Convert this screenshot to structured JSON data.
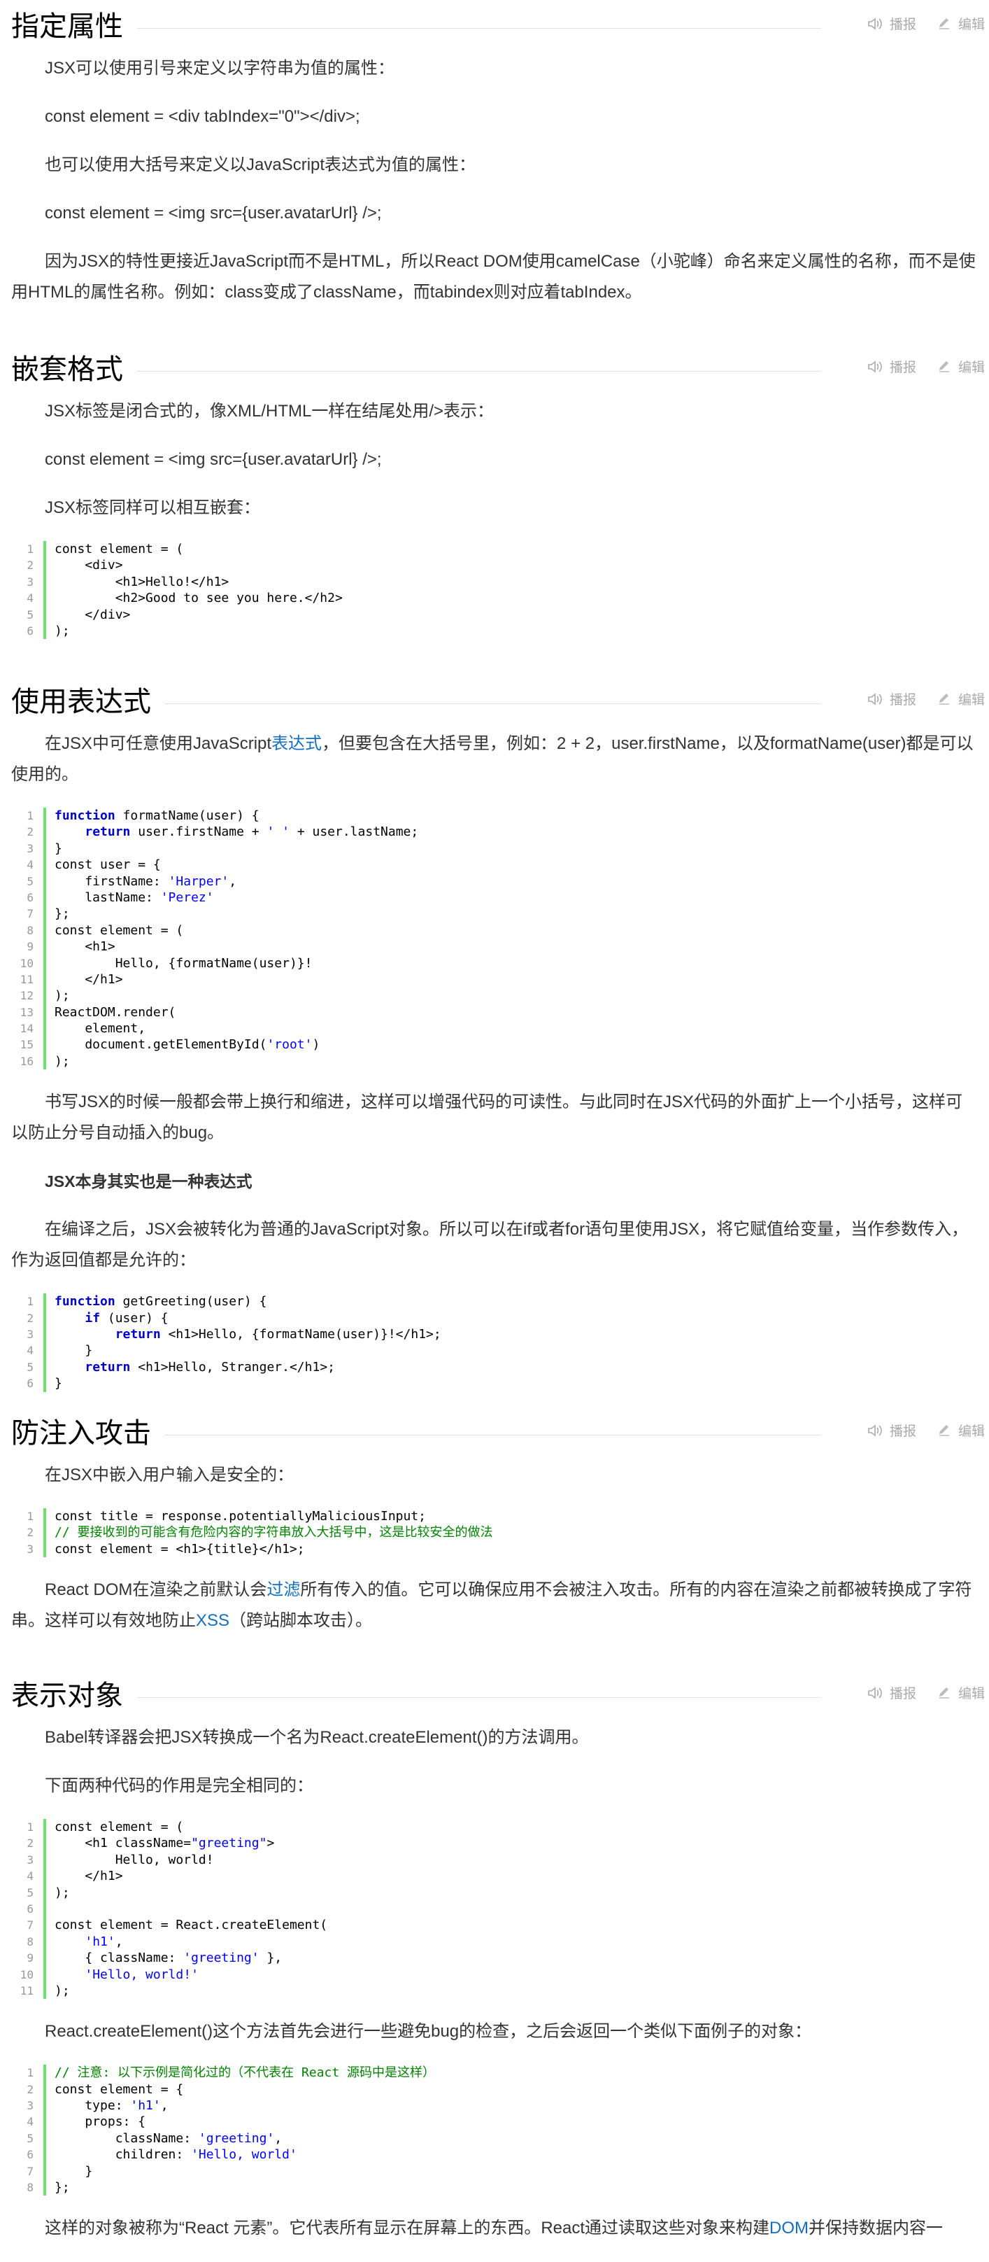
{
  "tools": {
    "listen": "播报",
    "edit": "编辑"
  },
  "sections": [
    {
      "title": "指定属性",
      "blocks": [
        {
          "type": "p",
          "text": "JSX可以使用引号来定义以字符串为值的属性："
        },
        {
          "type": "p",
          "text": "const element = <div tabIndex=\"0\"></div>;"
        },
        {
          "type": "p",
          "text": "也可以使用大括号来定义以JavaScript表达式为值的属性："
        },
        {
          "type": "p",
          "text": "const element = <img src={user.avatarUrl} />;"
        },
        {
          "type": "p",
          "text": "因为JSX的特性更接近JavaScript而不是HTML，所以React DOM使用camelCase（小驼峰）命名来定义属性的名称，而不是使用HTML的属性名称。例如：class变成了className，而tabindex则对应着tabIndex。"
        }
      ]
    },
    {
      "title": "嵌套格式",
      "blocks": [
        {
          "type": "p",
          "text": "JSX标签是闭合式的，像XML/HTML一样在结尾处用/>表示："
        },
        {
          "type": "p",
          "text": "const element = <img src={user.avatarUrl} />;"
        },
        {
          "type": "p",
          "text": "JSX标签同样可以相互嵌套："
        },
        {
          "type": "code",
          "lines": [
            "const element = (",
            "    <div>",
            "        <h1>Hello!</h1>",
            "        <h2>Good to see you here.</h2>",
            "    </div>",
            ");"
          ]
        }
      ]
    },
    {
      "title": "使用表达式",
      "blocks": [
        {
          "type": "p",
          "text_before": "在JSX中可任意使用JavaScript",
          "link": "表达式",
          "text_after": "，但要包含在大括号里，例如：2 + 2，user.firstName，以及formatName(user)都是可以使用的。"
        },
        {
          "type": "code",
          "lines": [
            "function formatName(user) {",
            "    return user.firstName + ' ' + user.lastName;",
            "}",
            "const user = {",
            "    firstName: 'Harper',",
            "    lastName: 'Perez'",
            "};",
            "const element = (",
            "    <h1>",
            "        Hello, {formatName(user)}!",
            "    </h1>",
            ");",
            "ReactDOM.render(",
            "    element,",
            "    document.getElementById('root')",
            ");"
          ]
        },
        {
          "type": "p",
          "text": "书写JSX的时候一般都会带上换行和缩进，这样可以增强代码的可读性。与此同时在JSX代码的外面扩上一个小括号，这样可以防止分号自动插入的bug。"
        },
        {
          "type": "pb",
          "text": "JSX本身其实也是一种表达式"
        },
        {
          "type": "p",
          "text": "在编译之后，JSX会被转化为普通的JavaScript对象。所以可以在if或者for语句里使用JSX，将它赋值给变量，当作参数传入，作为返回值都是允许的："
        },
        {
          "type": "code",
          "lines": [
            "function getGreeting(user) {",
            "    if (user) {",
            "        return <h1>Hello, {formatName(user)}!</h1>;",
            "    }",
            "    return <h1>Hello, Stranger.</h1>;",
            "}"
          ]
        }
      ]
    },
    {
      "title": "防注入攻击",
      "blocks": [
        {
          "type": "p",
          "text": "在JSX中嵌入用户输入是安全的："
        },
        {
          "type": "code",
          "lines": [
            "const title = response.potentiallyMaliciousInput;",
            "// 要接收到的可能含有危险内容的字符串放入大括号中，这是比较安全的做法",
            "const element = <h1>{title}</h1>;"
          ]
        },
        {
          "type": "p",
          "text_before": "React DOM在渲染之前默认会",
          "link": "过滤",
          "text_after": "所有传入的值。它可以确保应用不会被注入攻击。所有的内容在渲染之前都被转换成了字符串。这样可以有效地防止",
          "link2": "XSS",
          "text_after2": "（跨站脚本攻击）。"
        }
      ]
    },
    {
      "title": "表示对象",
      "blocks": [
        {
          "type": "p",
          "text": "Babel转译器会把JSX转换成一个名为React.createElement()的方法调用。"
        },
        {
          "type": "p",
          "text": "下面两种代码的作用是完全相同的："
        },
        {
          "type": "code",
          "lines": [
            "const element = (",
            "    <h1 className=\"greeting\">",
            "        Hello, world!",
            "    </h1>",
            ");",
            "",
            "const element = React.createElement(",
            "    'h1',",
            "    { className: 'greeting' },",
            "    'Hello, world!'",
            ");"
          ]
        },
        {
          "type": "p",
          "text": "React.createElement()这个方法首先会进行一些避免bug的检查，之后会返回一个类似下面例子的对象："
        },
        {
          "type": "code",
          "lines": [
            "// 注意: 以下示例是简化过的（不代表在 React 源码中是这样）",
            "const element = {",
            "    type: 'h1',",
            "    props: {",
            "        className: 'greeting',",
            "        children: 'Hello, world'",
            "    }",
            "};"
          ]
        },
        {
          "type": "p",
          "text_before": "这样的对象被称为“React 元素”。它代表所有显示在屏幕上的东西。React通过读取这些对象来构建",
          "link": "DOM",
          "text_after": "并保持数据内容一"
        }
      ]
    }
  ]
}
